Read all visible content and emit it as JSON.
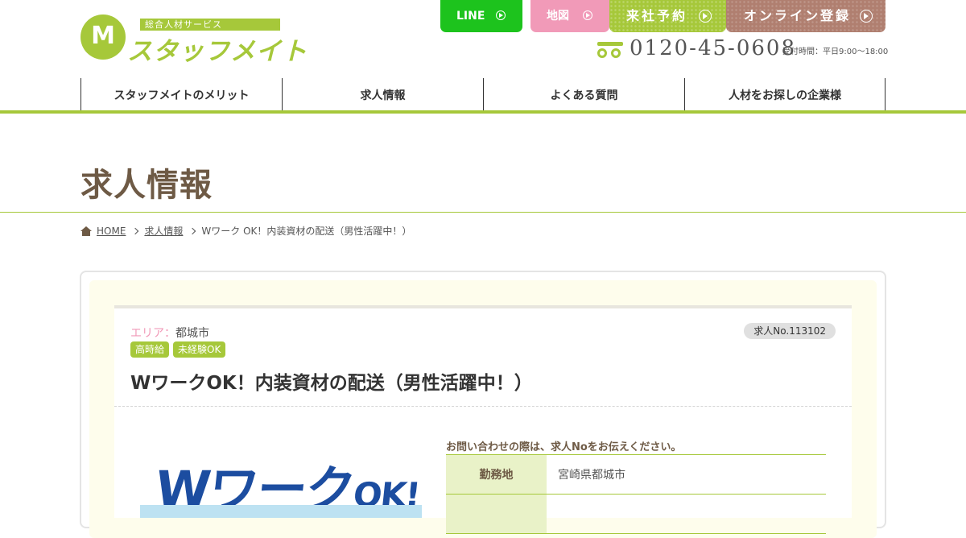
{
  "brand": {
    "tagline": "総合人材サービス",
    "name": "スタッフメイト",
    "accent": "#a6c83a"
  },
  "header_buttons": {
    "line": "LINE",
    "map": "地図",
    "visit": "来社予約",
    "online": "オンライン登録"
  },
  "contact": {
    "phone": "0120-45-0608",
    "hours": "受付時間：平日9:00～18:00"
  },
  "nav": [
    {
      "label": "スタッフメイトのメリット"
    },
    {
      "label": "求人情報"
    },
    {
      "label": "よくある質問"
    },
    {
      "label": "人材をお探しの企業様"
    }
  ],
  "page_title": "求人情報",
  "breadcrumb": {
    "home": "HOME",
    "section": "求人情報",
    "current": "Wワーク OK！内装資材の配送（男性活躍中！）"
  },
  "job": {
    "area_label": "エリア：",
    "area": "都城市",
    "job_no": "求人No.113102",
    "tags": [
      "高時給",
      "未経験OK"
    ],
    "title": "WワークOK！内装資材の配送（男性活躍中！）",
    "image": {
      "main": "Wワーク",
      "suffix": "OK!"
    },
    "note": "お問い合わせの際は、求人Noをお伝えください。",
    "details": [
      {
        "label": "勤務地",
        "value": "宮崎県都城市"
      },
      {
        "label": "",
        "value": ""
      }
    ]
  }
}
